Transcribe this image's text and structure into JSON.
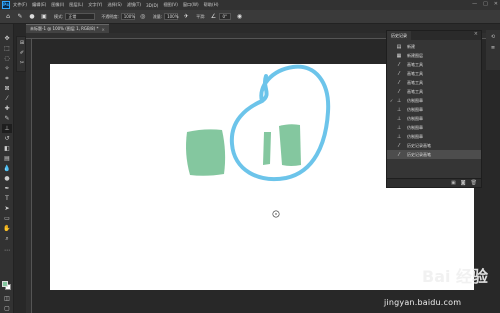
{
  "app": {
    "logo": "Ps"
  },
  "menu": [
    "文件(F)",
    "编辑(E)",
    "图像(I)",
    "图层(L)",
    "文字(Y)",
    "选择(S)",
    "滤镜(T)",
    "3D(D)",
    "视图(V)",
    "窗口(W)",
    "帮助(H)"
  ],
  "window_controls": [
    "—",
    "□",
    "✕"
  ],
  "options": {
    "mode_label": "模式:",
    "mode_value": "正常",
    "opacity_label": "不透明度:",
    "opacity_value": "100%",
    "flow_label": "流量:",
    "flow_value": "100%",
    "smooth_label": "平滑:",
    "angle_value": "0°"
  },
  "document_tab": {
    "title": "未标题-1 @ 100% (图层 1, RGB/8) *",
    "close": "×"
  },
  "history_panel": {
    "title": "历史记录",
    "close": "×",
    "items": [
      {
        "icon": "document-icon",
        "label": "新建",
        "selected": false,
        "marker": ""
      },
      {
        "icon": "layer-icon",
        "label": "新建图层",
        "selected": false,
        "marker": ""
      },
      {
        "icon": "brush-icon",
        "label": "画笔工具",
        "selected": false,
        "marker": ""
      },
      {
        "icon": "brush-icon",
        "label": "画笔工具",
        "selected": false,
        "marker": ""
      },
      {
        "icon": "brush-icon",
        "label": "画笔工具",
        "selected": false,
        "marker": ""
      },
      {
        "icon": "brush-icon",
        "label": "画笔工具",
        "selected": false,
        "marker": ""
      },
      {
        "icon": "stamp-icon",
        "label": "仿制图章",
        "selected": false,
        "marker": "✓"
      },
      {
        "icon": "stamp-icon",
        "label": "仿制图章",
        "selected": false,
        "marker": ""
      },
      {
        "icon": "stamp-icon",
        "label": "仿制图章",
        "selected": false,
        "marker": ""
      },
      {
        "icon": "stamp-icon",
        "label": "仿制图章",
        "selected": false,
        "marker": ""
      },
      {
        "icon": "stamp-icon",
        "label": "仿制图章",
        "selected": false,
        "marker": ""
      },
      {
        "icon": "brush-icon",
        "label": "历史记录画笔",
        "selected": false,
        "marker": ""
      },
      {
        "icon": "brush-icon",
        "label": "历史记录画笔",
        "selected": true,
        "marker": ""
      }
    ]
  },
  "watermark": {
    "logo": "Bai 经验",
    "url": "jingyan.baidu.com"
  },
  "colors": {
    "green_paint": "#84c79f",
    "blue_stroke": "#6cc4ea",
    "canvas": "#ffffff",
    "workspace": "#282828"
  }
}
